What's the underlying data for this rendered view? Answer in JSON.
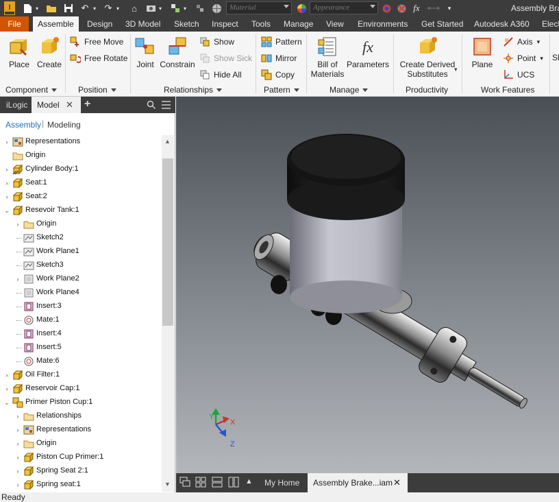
{
  "title_bar": {
    "material_placeholder": "Material",
    "appearance_placeholder": "Appearance",
    "app_title": "Assembly Bra"
  },
  "tabs": [
    "File",
    "Assemble",
    "Design",
    "3D Model",
    "Sketch",
    "Inspect",
    "Tools",
    "Manage",
    "View",
    "Environments",
    "Get Started",
    "Autodesk A360",
    "Elect"
  ],
  "ribbon": {
    "place": "Place",
    "create": "Create",
    "free_move": "Free Move",
    "free_rotate": "Free Rotate",
    "joint": "Joint",
    "constrain": "Constrain",
    "show": "Show",
    "show_sick": "Show Sick",
    "hide_all": "Hide All",
    "pattern": "Pattern",
    "mirror": "Mirror",
    "copy": "Copy",
    "bill_of_materials": [
      "Bill of",
      "Materials"
    ],
    "parameters": "Parameters",
    "create_derived": [
      "Create Derived",
      "Substitutes"
    ],
    "plane": "Plane",
    "axis": "Axis",
    "point": "Point",
    "ucs": "UCS",
    "sh": "Sh",
    "groups": [
      "Component",
      "Position",
      "Relationships",
      "Pattern",
      "Manage",
      "Productivity",
      "Work Features"
    ]
  },
  "browser": {
    "tab_ilogic": "iLogic",
    "tab_model": "Model",
    "add_tab": "+",
    "mode_assembly": "Assembly",
    "mode_modeling": "Modeling",
    "nodes": [
      {
        "label": "Representations",
        "level": 0,
        "icon": "representations",
        "expand": "collapsed"
      },
      {
        "label": "Origin",
        "level": 0,
        "icon": "folder",
        "expand": "none"
      },
      {
        "label": "Cylinder Body:1",
        "level": 0,
        "icon": "part-grounded",
        "expand": "collapsed"
      },
      {
        "label": "Seat:1",
        "level": 0,
        "icon": "part",
        "expand": "collapsed"
      },
      {
        "label": "Seat:2",
        "level": 0,
        "icon": "part",
        "expand": "collapsed"
      },
      {
        "label": "Resevoir Tank:1",
        "level": 0,
        "icon": "part",
        "expand": "expanded"
      },
      {
        "label": "Origin",
        "level": 1,
        "icon": "folder",
        "expand": "collapsed"
      },
      {
        "label": "Sketch2",
        "level": 1,
        "icon": "sketch",
        "expand": "none"
      },
      {
        "label": "Work Plane1",
        "level": 1,
        "icon": "sketch",
        "expand": "none"
      },
      {
        "label": "Sketch3",
        "level": 1,
        "icon": "sketch",
        "expand": "none"
      },
      {
        "label": "Work Plane2",
        "level": 1,
        "icon": "workplane",
        "expand": "collapsed"
      },
      {
        "label": "Work Plane4",
        "level": 1,
        "icon": "workplane",
        "expand": "none"
      },
      {
        "label": "Insert:3",
        "level": 1,
        "icon": "insert",
        "expand": "none"
      },
      {
        "label": "Mate:1",
        "level": 1,
        "icon": "mate",
        "expand": "none"
      },
      {
        "label": "Insert:4",
        "level": 1,
        "icon": "insert",
        "expand": "none"
      },
      {
        "label": "Insert:5",
        "level": 1,
        "icon": "insert",
        "expand": "none"
      },
      {
        "label": "Mate:6",
        "level": 1,
        "icon": "mate",
        "expand": "none"
      },
      {
        "label": "Oil Filter:1",
        "level": 0,
        "icon": "part",
        "expand": "collapsed"
      },
      {
        "label": "Reservoir Cap:1",
        "level": 0,
        "icon": "part",
        "expand": "collapsed"
      },
      {
        "label": "Primer Piston Cup:1",
        "level": 0,
        "icon": "assembly",
        "expand": "expanded"
      },
      {
        "label": "Relationships",
        "level": 1,
        "icon": "folder",
        "expand": "collapsed"
      },
      {
        "label": "Representations",
        "level": 1,
        "icon": "representations",
        "expand": "collapsed"
      },
      {
        "label": "Origin",
        "level": 1,
        "icon": "folder",
        "expand": "collapsed"
      },
      {
        "label": "Piston Cup Primer:1",
        "level": 1,
        "icon": "part",
        "expand": "collapsed"
      },
      {
        "label": "Spring Seat 2:1",
        "level": 1,
        "icon": "part",
        "expand": "collapsed"
      },
      {
        "label": "Spring seat:1",
        "level": 1,
        "icon": "part",
        "expand": "collapsed"
      }
    ]
  },
  "viewcube": {
    "x": "X",
    "y": "Y",
    "z": "Z"
  },
  "doc_tabs": {
    "home": "My Home",
    "active": "Assembly Brake...iam",
    "close": "✕"
  },
  "status": "Ready"
}
